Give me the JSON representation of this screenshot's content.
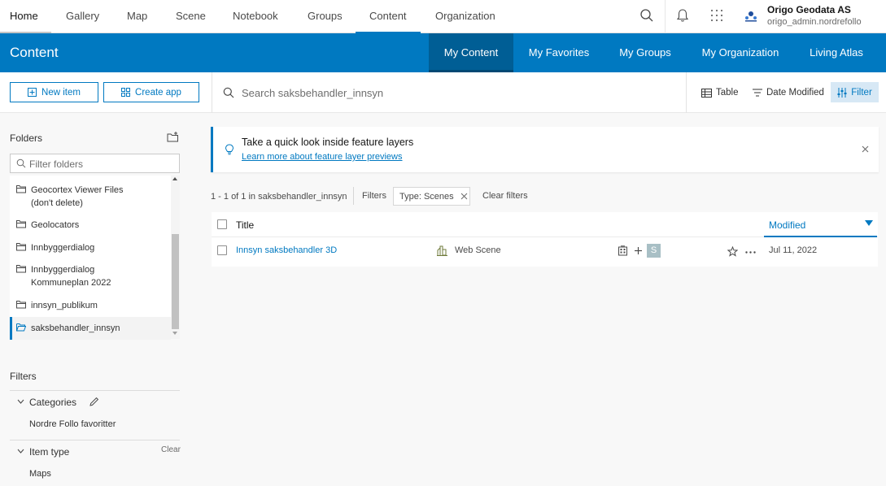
{
  "nav": {
    "tabs": [
      "Home",
      "Gallery",
      "Map",
      "Scene",
      "Notebook",
      "Groups",
      "Content",
      "Organization"
    ],
    "active_tab": "Content",
    "user_name": "Origo Geodata AS",
    "user_id": "origo_admin.nordrefollo",
    "icons": [
      "search-icon",
      "bell-icon",
      "app-launcher-icon",
      "org-logo"
    ]
  },
  "content_bar": {
    "title": "Content",
    "tabs": [
      "My Content",
      "My Favorites",
      "My Groups",
      "My Organization",
      "Living Atlas"
    ],
    "active_tab": "My Content",
    "color": "#0079c1",
    "active_color": "#005e95"
  },
  "toolbar": {
    "new_item": "New item",
    "create_app": "Create app",
    "search_placeholder": "Search saksbehandler_innsyn",
    "table_label": "Table",
    "sort_label": "Date Modified",
    "filter_label": "Filter"
  },
  "sidebar": {
    "folders_heading": "Folders",
    "folder_filter_placeholder": "Filter folders",
    "folders": [
      {
        "line1": "Geocortex Viewer Files",
        "line2": "(don't delete)"
      },
      {
        "line1": "Geolocators",
        "line2": ""
      },
      {
        "line1": "Innbyggerdialog",
        "line2": ""
      },
      {
        "line1": "Innbyggerdialog",
        "line2": "Kommuneplan 2022"
      },
      {
        "line1": "innsyn_publikum",
        "line2": ""
      },
      {
        "line1": "saksbehandler_innsyn",
        "line2": ""
      }
    ],
    "active_folder": "saksbehandler_innsyn",
    "filters_heading": "Filters",
    "categories_label": "Categories",
    "category_value": "Nordre Follo favoritter",
    "item_type_label": "Item type",
    "clear_label": "Clear",
    "item_type_value": "Maps"
  },
  "banner": {
    "title": "Take a quick look inside feature layers",
    "link": "Learn more about feature layer previews"
  },
  "results": {
    "count_text": "1 - 1 of 1 in saksbehandler_innsyn",
    "filters_label": "Filters",
    "chip_label": "Type: Scenes",
    "clear_filters": "Clear filters"
  },
  "table": {
    "col_title": "Title",
    "col_modified": "Modified",
    "rows": [
      {
        "title": "Innsyn saksbehandler 3D",
        "type": "Web Scene",
        "badge": "S",
        "modified": "Jul 11, 2022"
      }
    ]
  }
}
